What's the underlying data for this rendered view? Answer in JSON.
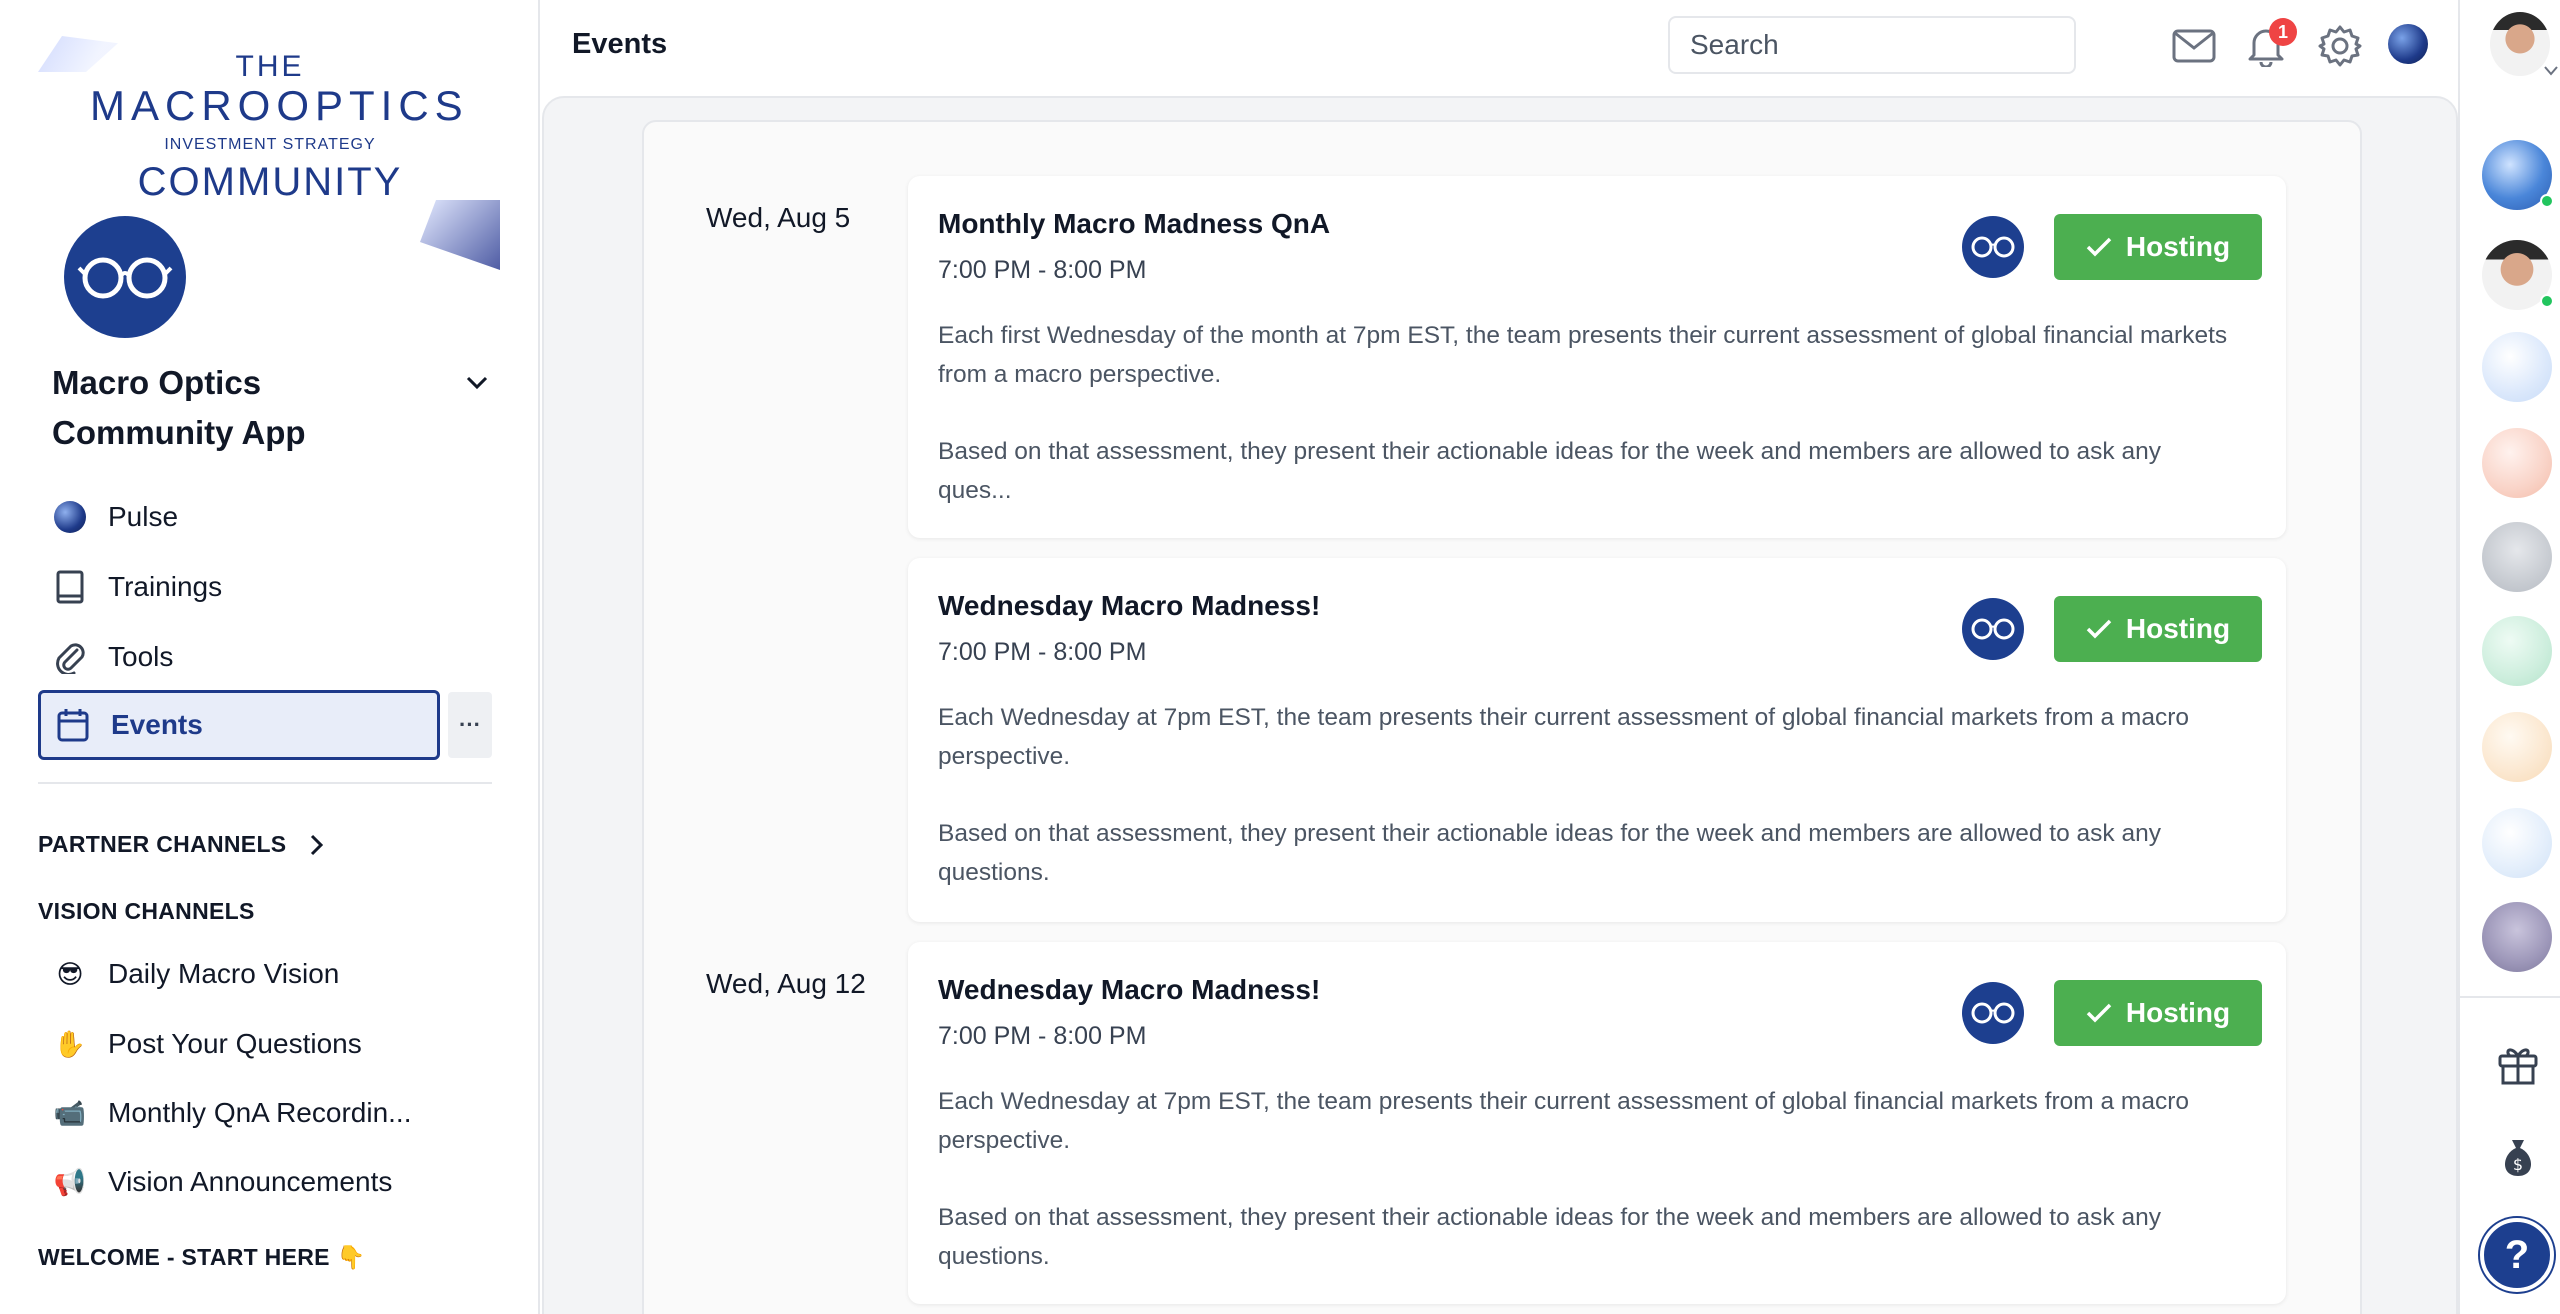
{
  "logo": {
    "line1": "THE",
    "line2": "MACROOPTICS",
    "line3": "INVESTMENT STRATEGY",
    "line4": "COMMUNITY"
  },
  "community": {
    "name": "Macro Optics Community App"
  },
  "nav": {
    "items": [
      {
        "label": "Pulse",
        "icon": "pulse-icon"
      },
      {
        "label": "Trainings",
        "icon": "book-icon"
      },
      {
        "label": "Tools",
        "icon": "paperclip-icon"
      },
      {
        "label": "Events",
        "icon": "calendar-icon",
        "active": true
      }
    ],
    "more": "···"
  },
  "sections": {
    "partner": "PARTNER CHANNELS",
    "vision": "VISION CHANNELS",
    "welcome": "WELCOME - START HERE 👇"
  },
  "vision_channels": [
    {
      "emoji": "😎",
      "label": "Daily Macro Vision"
    },
    {
      "emoji": "✋",
      "label": "Post Your Questions"
    },
    {
      "emoji": "📹",
      "label": "Monthly QnA Recordin..."
    },
    {
      "emoji": "📢",
      "label": "Vision Announcements"
    }
  ],
  "topbar": {
    "title": "Events",
    "search_placeholder": "Search",
    "notifications_count": "1"
  },
  "events": {
    "dates": [
      "Wed, Aug 5",
      "Wed, Aug 12"
    ],
    "items": [
      {
        "title": "Monthly Macro Madness QnA",
        "time": "7:00 PM - 8:00 PM",
        "desc1": "Each first Wednesday of the month at 7pm EST, the team presents their current assessment of global financial markets from a macro perspective.",
        "desc2": "Based on that assessment, they present their actionable ideas for the week and members are allowed to ask any ques...",
        "status": "Hosting"
      },
      {
        "title": "Wednesday Macro Madness!",
        "time": "7:00 PM - 8:00 PM",
        "desc1": "Each Wednesday at 7pm EST, the team presents their current assessment of global financial markets from a macro perspective.",
        "desc2": "Based on that assessment, they present their actionable ideas for the week and members are allowed to ask any questions.",
        "status": "Hosting"
      },
      {
        "title": "Wednesday Macro Madness!",
        "time": "7:00 PM - 8:00 PM",
        "desc1": "Each Wednesday at 7pm EST, the team presents their current assessment of global financial markets from a macro perspective.",
        "desc2": "Based on that assessment, they present their actionable ideas for the week and members are allowed to ask any questions.",
        "status": "Hosting"
      }
    ]
  },
  "right_rail": {
    "help": "?"
  },
  "colors": {
    "brand": "#1d3f8f",
    "hosting": "#4caf50",
    "badge": "#ef4444",
    "online": "#22c55e"
  }
}
